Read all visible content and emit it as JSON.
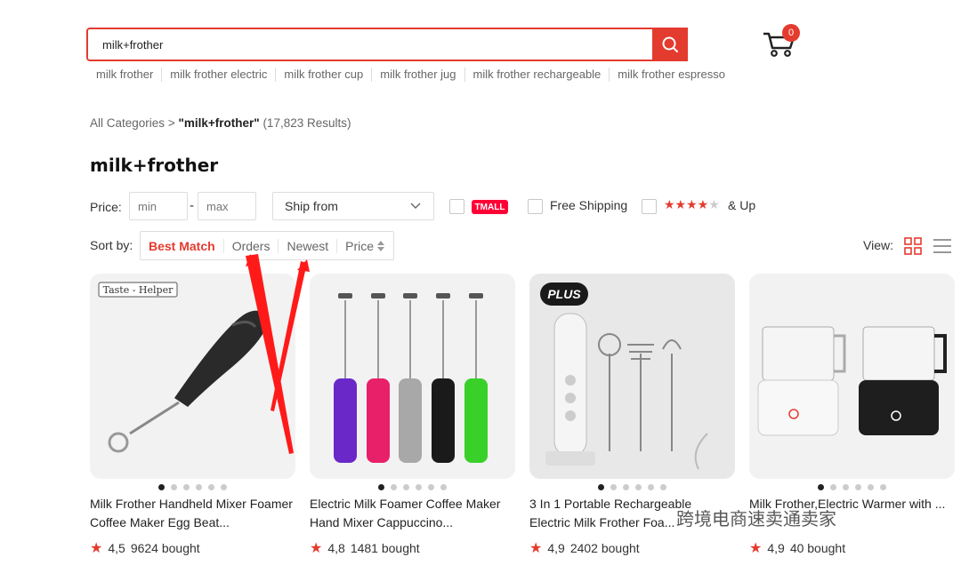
{
  "search": {
    "value": "milk+frother"
  },
  "cart": {
    "count": "0"
  },
  "suggestions": [
    "milk frother",
    "milk frother electric",
    "milk frother cup",
    "milk frother jug",
    "milk frother rechargeable",
    "milk frother espresso"
  ],
  "breadcrumb": {
    "root": "All Categories",
    "separator": ">",
    "query": "\"milk+frother\"",
    "results": "(17,823 Results)"
  },
  "page_title": "milk+frother",
  "filters": {
    "price_label": "Price:",
    "min_placeholder": "min",
    "max_placeholder": "max",
    "dash": "-",
    "ship_from": "Ship from",
    "tmall": "TMALL",
    "free_shipping": "Free Shipping",
    "stars": "★★★★★",
    "and_up": "& Up"
  },
  "sort": {
    "label": "Sort by:",
    "options": [
      "Best Match",
      "Orders",
      "Newest",
      "Price"
    ],
    "active": "Best Match"
  },
  "view": {
    "label": "View:"
  },
  "products": [
    {
      "title": "Milk Frother Handheld Mixer Foamer Coffee Maker Egg Beat...",
      "rating": "4,5",
      "bought": "9624 bought",
      "image_text": "Taste - Helper"
    },
    {
      "title": "Electric Milk Foamer Coffee Maker Hand Mixer Cappuccino...",
      "rating": "4,8",
      "bought": "1481 bought",
      "image_text": ""
    },
    {
      "title": "3 In 1 Portable Rechargeable Electric Milk Frother Foa...",
      "rating": "4,9",
      "bought": "2402 bought",
      "image_text": "PLUS"
    },
    {
      "title": "Milk Frother,Electric Warmer with ...",
      "rating": "4,9",
      "bought": "40 bought",
      "image_text": ""
    }
  ],
  "watermark": "跨境电商速卖通卖家",
  "colors": {
    "accent": "#e43b2f",
    "tmall": "#ff0036"
  }
}
